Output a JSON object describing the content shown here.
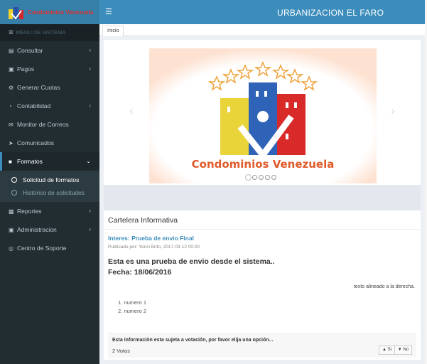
{
  "app": {
    "logo_text": "Condominios Venezuela",
    "site_title": "URBANIZACION EL FARO",
    "toggle_icon": "hamburger-icon"
  },
  "sidebar": {
    "header": "MENU DE SISTEMA",
    "items": [
      {
        "label": "Consultar",
        "icon": "clipboard-icon",
        "has_children": true
      },
      {
        "label": "Pagos",
        "icon": "money-icon",
        "has_children": true
      },
      {
        "label": "Generar Cuotas",
        "icon": "cogs-icon",
        "has_children": false
      },
      {
        "label": "Contabilidad",
        "icon": "pie-chart-icon",
        "has_children": true
      },
      {
        "label": "Monitor de Correos",
        "icon": "envelope-icon",
        "has_children": false
      },
      {
        "label": "Comunicados",
        "icon": "bullhorn-icon",
        "has_children": false
      },
      {
        "label": "Formatos",
        "icon": "file-icon",
        "has_children": true,
        "expanded": true
      },
      {
        "label": "Reportes",
        "icon": "bar-chart-icon",
        "has_children": true
      },
      {
        "label": "Administracion",
        "icon": "briefcase-icon",
        "has_children": true
      },
      {
        "label": "Centro de Soporte",
        "icon": "life-ring-icon",
        "has_children": false
      }
    ],
    "formatos_sub": [
      "Solicitud de formatos",
      "Histórico de solicitudes"
    ]
  },
  "tabs": [
    "Inicio"
  ],
  "carousel": {
    "banner_text": "Condominios Venezuela",
    "slides": 5,
    "active_slide": 1
  },
  "board": {
    "title": "Cartelera Informativa",
    "post_title": "Interes:  Prueba de envio Final",
    "post_meta": "Publicado por:  Yenci Brito, 2017-03-12 00:00",
    "body_line1": "Esta es una prueba de envio desde el sistema..",
    "body_line2": "Fecha: 18/06/2016",
    "right_text": "texto alineado a la derecha.",
    "list": [
      "1. numero 1",
      "2. numero 2"
    ],
    "vote_question": "Esta información esta sujeta a votación, por favor elija una opción...",
    "vote_count": "2 Votos",
    "vote_yes": "Si",
    "vote_no": "No"
  },
  "colors": {
    "header_dark": "#367fa9",
    "header": "#3c8dbc",
    "sidebar_bg": "#222d32",
    "accent": "#3c8dbc",
    "brand_red": "#e0312a"
  }
}
